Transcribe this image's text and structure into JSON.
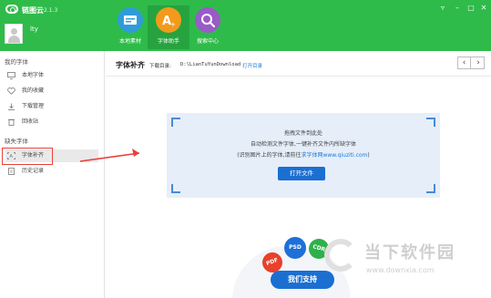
{
  "app": {
    "name": "链图云",
    "version": "2.1.3"
  },
  "user": {
    "name": "lty"
  },
  "nav": [
    {
      "label": "本地素材"
    },
    {
      "label": "字体助手"
    },
    {
      "label": "搜索中心"
    }
  ],
  "sidebar": {
    "section1_title": "我的字体",
    "section1_items": [
      {
        "label": "本地字体"
      },
      {
        "label": "我的收藏"
      },
      {
        "label": "下载管理"
      },
      {
        "label": "回收站"
      }
    ],
    "section2_title": "缺失字体",
    "section2_items": [
      {
        "label": "字体补齐"
      },
      {
        "label": "历史记录"
      }
    ]
  },
  "main": {
    "title": "字体补齐",
    "download_label": "下载目录:",
    "download_path": "D:\\LianTuYunDownload",
    "open_dir_label": "打开目录"
  },
  "dropzone": {
    "line1": "拖拽文件到此处",
    "line2": "自动检测文件字体,一键补齐文件内所缺字体",
    "line3_prefix": "(识别图片上的字体,请前往",
    "line3_link": "求字体网www.qiuziti.com",
    "line3_suffix": ")",
    "button_label": "打开文件"
  },
  "promo": {
    "badge_pdf": "PDF",
    "badge_psd": "PSD",
    "badge_cdr": "CDR",
    "button_label": "我们支持"
  },
  "watermark": {
    "name": "当下软件园",
    "url": "www.downxia.com"
  },
  "colors": {
    "header_green": "#2fbb4a",
    "accent_blue": "#1b6fd1",
    "highlight_red": "#e8413a"
  }
}
